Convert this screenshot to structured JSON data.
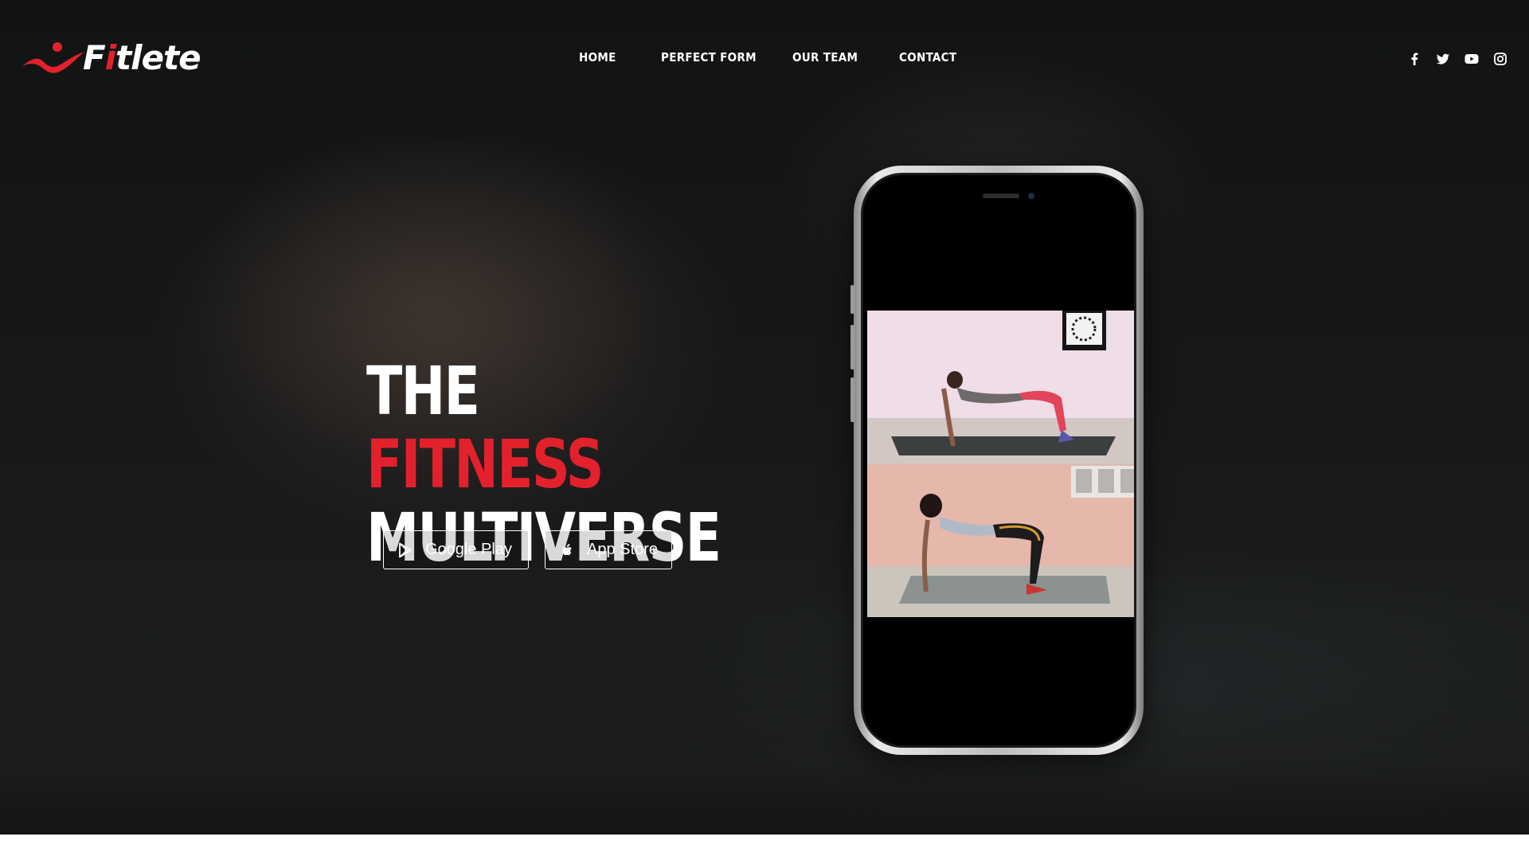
{
  "brand": {
    "name_prefix": "F",
    "name_accent": "i",
    "name_suffix": "tlete",
    "accent_color": "#e3212c",
    "logo_icon": "runner-swoosh-icon"
  },
  "nav": {
    "items": [
      {
        "label": "HOME"
      },
      {
        "label": "PERFECT FORM"
      },
      {
        "label": "OUR TEAM"
      },
      {
        "label": "CONTACT"
      }
    ]
  },
  "social": {
    "icons": [
      "facebook-icon",
      "twitter-icon",
      "youtube-icon",
      "instagram-icon"
    ]
  },
  "hero": {
    "headline_word1": "THE",
    "headline_word2": "FITNESS",
    "headline_line2": "MULTIVERSE",
    "buttons": {
      "google_play": "Google Play",
      "app_store": "App Store"
    }
  },
  "colors": {
    "accent": "#e3212c",
    "text": "#ffffff"
  }
}
